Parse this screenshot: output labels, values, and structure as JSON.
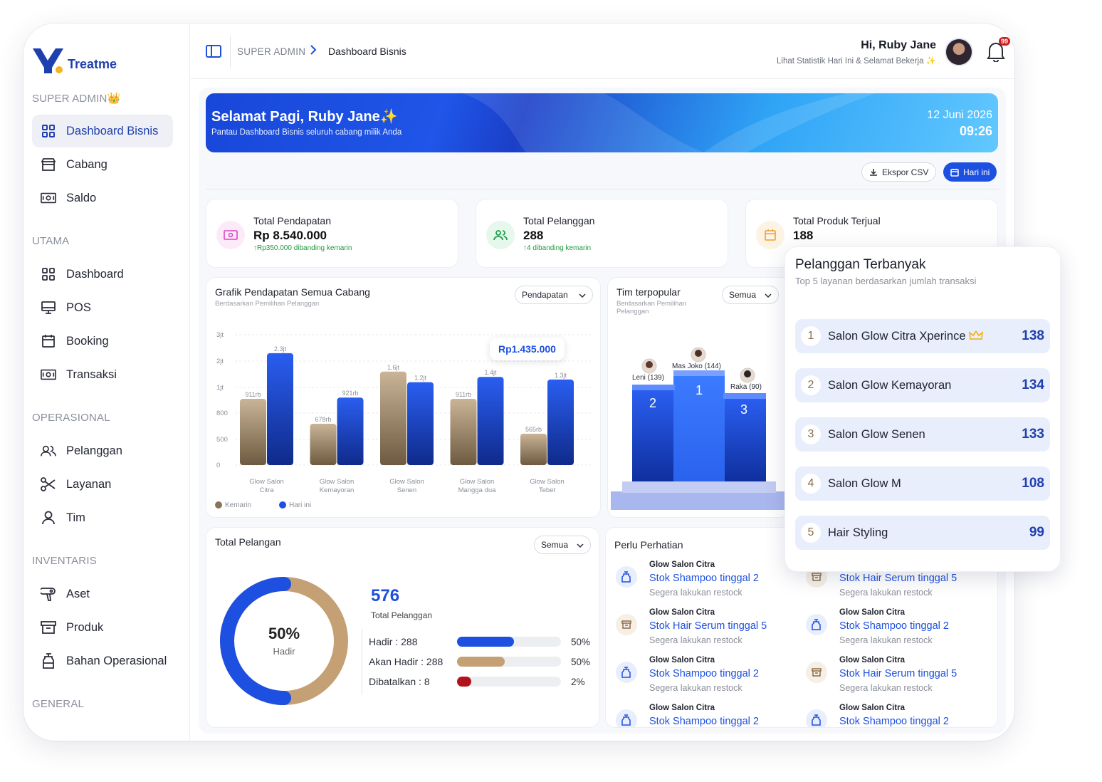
{
  "brand": {
    "name": "Treatme"
  },
  "sidebar": {
    "section_super": "SUPER ADMIN👑",
    "item_dashboard_bisnis": "Dashboard Bisnis",
    "item_cabang": "Cabang",
    "item_saldo": "Saldo",
    "section_utama": "UTAMA",
    "item_dashboard": "Dashboard",
    "item_pos": "POS",
    "item_booking": "Booking",
    "item_transaksi": "Transaksi",
    "section_operasional": "OPERASIONAL",
    "item_pelanggan": "Pelanggan",
    "item_layanan": "Layanan",
    "item_tim": "Tim",
    "section_inventaris": "INVENTARIS",
    "item_aset": "Aset",
    "item_produk": "Produk",
    "item_bahan": "Bahan Operasional",
    "section_general": "GENERAL"
  },
  "header": {
    "crumb_root": "SUPER ADMIN",
    "crumb_current": "Dashboard Bisnis",
    "greeting": "Hi, Ruby Jane",
    "subtitle": "Lihat Statistik Hari Ini & Selamat Bekerja ✨",
    "notif_count": "99"
  },
  "banner": {
    "title": "Selamat Pagi, Ruby Jane✨",
    "subtitle": "Pantau Dashboard Bisnis seluruh cabang milik Anda",
    "date": "12 Juni 2026",
    "time": "09:26"
  },
  "actions": {
    "export": "Ekspor CSV",
    "today": "Hari ini"
  },
  "stats": [
    {
      "title": "Total Pendapatan",
      "value": "Rp 8.540.000",
      "delta": "↑Rp350.000 dibanding kemarin",
      "color": "#d946c8"
    },
    {
      "title": "Total Pelanggan",
      "value": "288",
      "delta": "↑4 dibanding kemarin",
      "color": "#22a04a"
    },
    {
      "title": "Total Produk Terjual",
      "value": "188",
      "delta": "",
      "color": "#f0a030"
    }
  ],
  "revenue_chart": {
    "title": "Grafik Pendapatan Semua Cabang",
    "subtitle": "Berdasarkan Pemilihan Pelanggan",
    "dropdown": "Pendapatan",
    "tooltip": "Rp1.435.000",
    "legend_prev": "Kemarin",
    "legend_today": "Hari ini"
  },
  "chart_data": {
    "type": "bar",
    "y_ticks": [
      "3jt",
      "2jt",
      "1jt",
      "800",
      "500",
      "0"
    ],
    "categories": [
      "Glow Salon Citra",
      "Glow Salon Kemayoran",
      "Glow Salon Senen",
      "Glow Salon Mangga dua",
      "Glow Salon Tebet"
    ],
    "series": [
      {
        "name": "Kemarin",
        "values": [
          911000,
          678000,
          1600000,
          911000,
          565000
        ],
        "labels": [
          "911rb",
          "678rb",
          "1.6jt",
          "911rb",
          "565rb"
        ],
        "color": "#a89070"
      },
      {
        "name": "Hari ini",
        "values": [
          2300000,
          921000,
          1200000,
          1400000,
          1300000
        ],
        "labels": [
          "2.3jt",
          "921rb",
          "1.2jt",
          "1.4jt",
          "1.3jt"
        ],
        "color": "#1d4fe0"
      }
    ]
  },
  "team": {
    "title": "Tim terpopular",
    "subtitle1": "Berdasarkan Pemilihan",
    "subtitle2": "Pelanggan",
    "dropdown": "Semua",
    "podium": [
      {
        "rank": "1",
        "label": "Mas Joko (144)"
      },
      {
        "rank": "2",
        "label": "Leni (139)"
      },
      {
        "rank": "3",
        "label": "Raka (90)"
      }
    ]
  },
  "attendance": {
    "title": "Total Pelangan",
    "dropdown": "Semua",
    "donut_pct": "50%",
    "donut_label": "Hadir",
    "total": "576",
    "total_label": "Total Pelanggan",
    "rows": [
      {
        "label": "Hadir : 288",
        "pct": "50%",
        "fraction": 0.55,
        "color": "#1d4fe0"
      },
      {
        "label": "Akan Hadir : 288",
        "pct": "50%",
        "fraction": 0.46,
        "color": "#c4a074"
      },
      {
        "label": "Dibatalkan : 8",
        "pct": "2%",
        "fraction": 0.14,
        "color": "#b0141a"
      }
    ]
  },
  "alerts": {
    "title": "Perlu Perhatian",
    "items": [
      {
        "branch": "Glow Salon Citra",
        "text": "Stok Shampoo tinggal 2",
        "note": "Segera lakukan restock",
        "kind": "bottle"
      },
      {
        "branch": "",
        "text": "Stok Hair Serum tinggal 5",
        "note": "Segera lakukan restock",
        "kind": "box"
      },
      {
        "branch": "Glow Salon Citra",
        "text": "Stok Hair Serum tinggal 5",
        "note": "Segera lakukan restock",
        "kind": "box"
      },
      {
        "branch": "Glow Salon Citra",
        "text": "Stok Shampoo tinggal 2",
        "note": "Segera lakukan restock",
        "kind": "bottle"
      },
      {
        "branch": "Glow Salon Citra",
        "text": "Stok Shampoo tinggal 2",
        "note": "Segera lakukan restock",
        "kind": "bottle"
      },
      {
        "branch": "Glow Salon Citra",
        "text": "Stok Hair Serum tinggal 5",
        "note": "Segera lakukan restock",
        "kind": "box"
      },
      {
        "branch": "Glow Salon Citra",
        "text": "Stok Shampoo tinggal 2",
        "note": "",
        "kind": "bottle"
      },
      {
        "branch": "Glow Salon Citra",
        "text": "Stok Shampoo tinggal 2",
        "note": "",
        "kind": "bottle"
      }
    ]
  },
  "top_customers": {
    "title": "Pelanggan Terbanyak",
    "subtitle": "Top 5 layanan berdasarkan jumlah transaksi",
    "items": [
      {
        "rank": "1",
        "name": "Salon Glow  Citra Xperince",
        "value": "138"
      },
      {
        "rank": "2",
        "name": "Salon Glow Kemayoran",
        "value": "134"
      },
      {
        "rank": "3",
        "name": "Salon Glow Senen",
        "value": "133"
      },
      {
        "rank": "4",
        "name": "Salon Glow M",
        "value": "108"
      },
      {
        "rank": "5",
        "name": "Hair Styling",
        "value": "99"
      }
    ]
  }
}
